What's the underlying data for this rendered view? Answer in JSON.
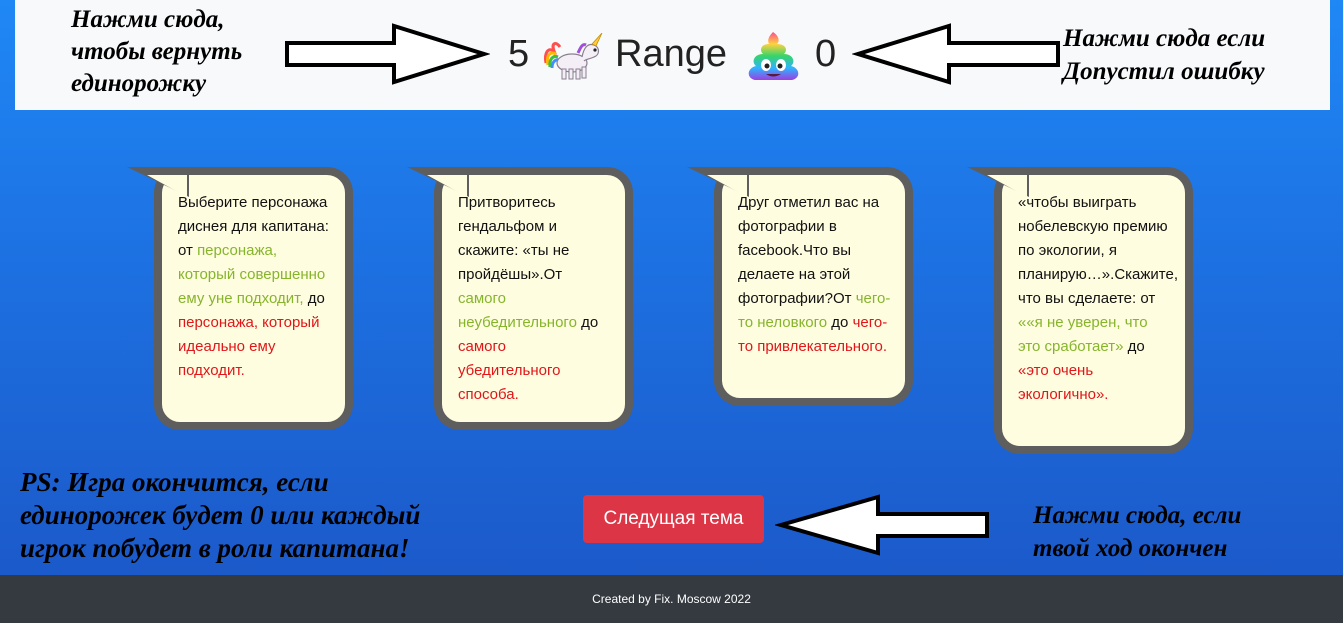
{
  "header": {
    "hint_left": "Нажми сюда,\nчтобы вернуть\nединорожку",
    "hint_right": "Нажми сюда если\nДопустил ошибку",
    "unicorn_count": "5",
    "title": "Range",
    "poop_count": "0",
    "unicorn_icon": "unicorn-icon",
    "poop_icon": "rainbow-poop-icon"
  },
  "cards": [
    {
      "parts": [
        {
          "text": "Выберите персонажа диснея для капитана: от ",
          "color": "plain"
        },
        {
          "text": "персонажа, который совершенно ему уне подходит,",
          "color": "green"
        },
        {
          "text": " до ",
          "color": "plain"
        },
        {
          "text": "персонажа, который идеально ему подходит",
          "color": "red"
        },
        {
          "text": ".",
          "color": "plain"
        }
      ]
    },
    {
      "parts": [
        {
          "text": "Притворитесь гендальфом и скажите: «ты не пройдёшы».От ",
          "color": "plain"
        },
        {
          "text": "самого неубедительного",
          "color": "green"
        },
        {
          "text": " до ",
          "color": "plain"
        },
        {
          "text": "самого убедительного способа",
          "color": "red"
        },
        {
          "text": ".",
          "color": "plain"
        }
      ]
    },
    {
      "parts": [
        {
          "text": "Друг отметил вас на фотографии в facebook.Что вы делаете на этой фотографии?От ",
          "color": "plain"
        },
        {
          "text": "чего-то неловкого",
          "color": "green"
        },
        {
          "text": " до ",
          "color": "plain"
        },
        {
          "text": "чего-то привлекательного",
          "color": "red"
        },
        {
          "text": ".",
          "color": "plain"
        }
      ]
    },
    {
      "parts": [
        {
          "text": "«чтобы выиграть нобелевскую премию по экологии, я планирую…».Скажите, что вы сделаете: от ",
          "color": "plain"
        },
        {
          "text": "««я не уверен, что это сработает»",
          "color": "green"
        },
        {
          "text": " до ",
          "color": "plain"
        },
        {
          "text": "«это очень экологично»",
          "color": "red"
        },
        {
          "text": ".",
          "color": "plain"
        }
      ]
    }
  ],
  "hint_ps": "PS: Игра окончится, если\nединорожек будет 0 или каждый\nигрок побудет в роли капитана!",
  "next_button_label": "Следущая тема",
  "hint_bottom_right": "Нажми сюда, если\nтвой ход окончен",
  "footer_text": "Created by Fix. Moscow 2022",
  "colors": {
    "green": "#86b52c",
    "red": "#e0161a",
    "card_bg": "#fffde0",
    "card_border": "#5e5e5e",
    "button": "#dc3545",
    "footer": "#343a40"
  }
}
